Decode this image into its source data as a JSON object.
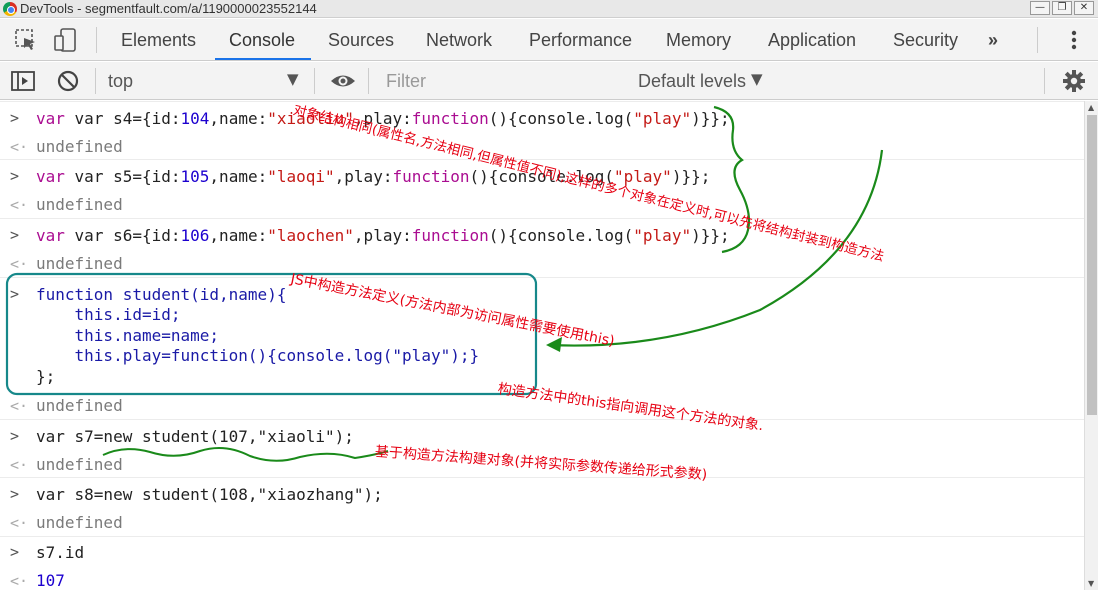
{
  "window": {
    "title": "DevTools - segmentfault.com/a/1190000023552144"
  },
  "tabs": [
    "Elements",
    "Console",
    "Sources",
    "Network",
    "Performance",
    "Memory",
    "Application",
    "Security"
  ],
  "active_tab": "Console",
  "toolbar": {
    "context": "top",
    "filter_placeholder": "Filter",
    "levels": "Default levels"
  },
  "console": {
    "s4": {
      "pre": "var s4={id:",
      "num": "104",
      "mid": ",name:",
      "str": "\"xiaoliu\"",
      "mid2": ",play:",
      "fn": "function",
      "tail": "(){console.log(",
      "s": "\"play\"",
      "end": ")}};"
    },
    "s5": {
      "pre": "var s5={id:",
      "num": "105",
      "mid": ",name:",
      "str": "\"laoqi\"",
      "mid2": ",play:",
      "fn": "function",
      "tail": "(){console.log(",
      "s": "\"play\"",
      "end": ")}};"
    },
    "s6": {
      "pre": "var s6={id:",
      "num": "106",
      "mid": ",name:",
      "str": "\"laochen\"",
      "mid2": ",play:",
      "fn": "function",
      "tail": "(){console.log(",
      "s": "\"play\"",
      "end": ")}};"
    },
    "undefined": "undefined",
    "func_lines": [
      "function student(id,name){",
      "    this.id=id;",
      "    this.name=name;",
      "    this.play=function(){console.log(\"play\");}",
      "};"
    ],
    "s7": "var s7=new student(107,\"xiaoli\");",
    "s8": "var s8=new student(108,\"xiaozhang\");",
    "s7id": "s7.id",
    "s7id_result": "107"
  },
  "annotations": {
    "a1": "对象结构相同(属性名,方法相同,但属性值不同),这样的多个对象在定义时,可以先将结构封装到构造方法",
    "a2": "JS中构造方法定义(方法内部为访问属性需要使用this)",
    "a3": "构造方法中的this指向调用这个方法的对象.",
    "a4": "基于构造方法构建对象(并将实际参数传递给形式参数)"
  },
  "colors": {
    "annotation": "#e60012",
    "box": "#16888a",
    "arrow": "#1a8a1a"
  }
}
